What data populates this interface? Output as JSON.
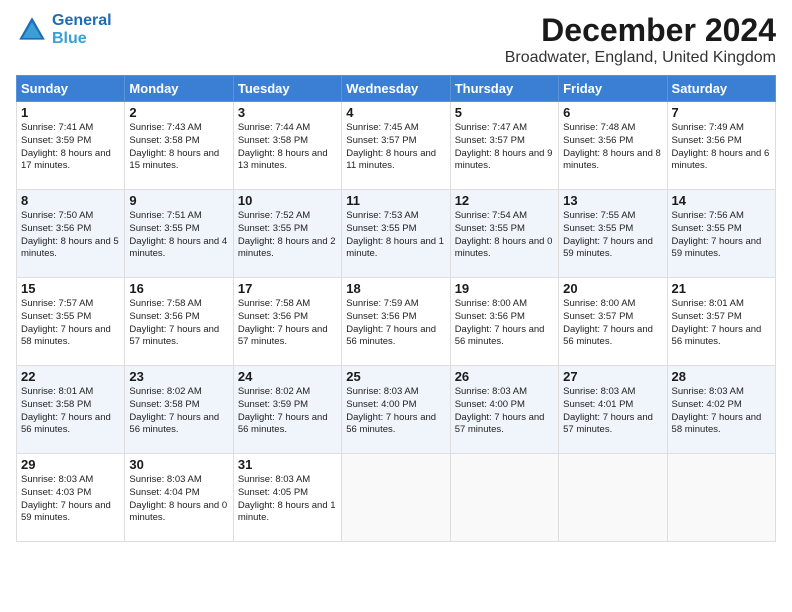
{
  "logo": {
    "line1": "General",
    "line2": "Blue"
  },
  "title": "December 2024",
  "location": "Broadwater, England, United Kingdom",
  "days_header": [
    "Sunday",
    "Monday",
    "Tuesday",
    "Wednesday",
    "Thursday",
    "Friday",
    "Saturday"
  ],
  "weeks": [
    [
      {
        "day": "1",
        "sunrise": "Sunrise: 7:41 AM",
        "sunset": "Sunset: 3:59 PM",
        "daylight": "Daylight: 8 hours and 17 minutes."
      },
      {
        "day": "2",
        "sunrise": "Sunrise: 7:43 AM",
        "sunset": "Sunset: 3:58 PM",
        "daylight": "Daylight: 8 hours and 15 minutes."
      },
      {
        "day": "3",
        "sunrise": "Sunrise: 7:44 AM",
        "sunset": "Sunset: 3:58 PM",
        "daylight": "Daylight: 8 hours and 13 minutes."
      },
      {
        "day": "4",
        "sunrise": "Sunrise: 7:45 AM",
        "sunset": "Sunset: 3:57 PM",
        "daylight": "Daylight: 8 hours and 11 minutes."
      },
      {
        "day": "5",
        "sunrise": "Sunrise: 7:47 AM",
        "sunset": "Sunset: 3:57 PM",
        "daylight": "Daylight: 8 hours and 9 minutes."
      },
      {
        "day": "6",
        "sunrise": "Sunrise: 7:48 AM",
        "sunset": "Sunset: 3:56 PM",
        "daylight": "Daylight: 8 hours and 8 minutes."
      },
      {
        "day": "7",
        "sunrise": "Sunrise: 7:49 AM",
        "sunset": "Sunset: 3:56 PM",
        "daylight": "Daylight: 8 hours and 6 minutes."
      }
    ],
    [
      {
        "day": "8",
        "sunrise": "Sunrise: 7:50 AM",
        "sunset": "Sunset: 3:56 PM",
        "daylight": "Daylight: 8 hours and 5 minutes."
      },
      {
        "day": "9",
        "sunrise": "Sunrise: 7:51 AM",
        "sunset": "Sunset: 3:55 PM",
        "daylight": "Daylight: 8 hours and 4 minutes."
      },
      {
        "day": "10",
        "sunrise": "Sunrise: 7:52 AM",
        "sunset": "Sunset: 3:55 PM",
        "daylight": "Daylight: 8 hours and 2 minutes."
      },
      {
        "day": "11",
        "sunrise": "Sunrise: 7:53 AM",
        "sunset": "Sunset: 3:55 PM",
        "daylight": "Daylight: 8 hours and 1 minute."
      },
      {
        "day": "12",
        "sunrise": "Sunrise: 7:54 AM",
        "sunset": "Sunset: 3:55 PM",
        "daylight": "Daylight: 8 hours and 0 minutes."
      },
      {
        "day": "13",
        "sunrise": "Sunrise: 7:55 AM",
        "sunset": "Sunset: 3:55 PM",
        "daylight": "Daylight: 7 hours and 59 minutes."
      },
      {
        "day": "14",
        "sunrise": "Sunrise: 7:56 AM",
        "sunset": "Sunset: 3:55 PM",
        "daylight": "Daylight: 7 hours and 59 minutes."
      }
    ],
    [
      {
        "day": "15",
        "sunrise": "Sunrise: 7:57 AM",
        "sunset": "Sunset: 3:55 PM",
        "daylight": "Daylight: 7 hours and 58 minutes."
      },
      {
        "day": "16",
        "sunrise": "Sunrise: 7:58 AM",
        "sunset": "Sunset: 3:56 PM",
        "daylight": "Daylight: 7 hours and 57 minutes."
      },
      {
        "day": "17",
        "sunrise": "Sunrise: 7:58 AM",
        "sunset": "Sunset: 3:56 PM",
        "daylight": "Daylight: 7 hours and 57 minutes."
      },
      {
        "day": "18",
        "sunrise": "Sunrise: 7:59 AM",
        "sunset": "Sunset: 3:56 PM",
        "daylight": "Daylight: 7 hours and 56 minutes."
      },
      {
        "day": "19",
        "sunrise": "Sunrise: 8:00 AM",
        "sunset": "Sunset: 3:56 PM",
        "daylight": "Daylight: 7 hours and 56 minutes."
      },
      {
        "day": "20",
        "sunrise": "Sunrise: 8:00 AM",
        "sunset": "Sunset: 3:57 PM",
        "daylight": "Daylight: 7 hours and 56 minutes."
      },
      {
        "day": "21",
        "sunrise": "Sunrise: 8:01 AM",
        "sunset": "Sunset: 3:57 PM",
        "daylight": "Daylight: 7 hours and 56 minutes."
      }
    ],
    [
      {
        "day": "22",
        "sunrise": "Sunrise: 8:01 AM",
        "sunset": "Sunset: 3:58 PM",
        "daylight": "Daylight: 7 hours and 56 minutes."
      },
      {
        "day": "23",
        "sunrise": "Sunrise: 8:02 AM",
        "sunset": "Sunset: 3:58 PM",
        "daylight": "Daylight: 7 hours and 56 minutes."
      },
      {
        "day": "24",
        "sunrise": "Sunrise: 8:02 AM",
        "sunset": "Sunset: 3:59 PM",
        "daylight": "Daylight: 7 hours and 56 minutes."
      },
      {
        "day": "25",
        "sunrise": "Sunrise: 8:03 AM",
        "sunset": "Sunset: 4:00 PM",
        "daylight": "Daylight: 7 hours and 56 minutes."
      },
      {
        "day": "26",
        "sunrise": "Sunrise: 8:03 AM",
        "sunset": "Sunset: 4:00 PM",
        "daylight": "Daylight: 7 hours and 57 minutes."
      },
      {
        "day": "27",
        "sunrise": "Sunrise: 8:03 AM",
        "sunset": "Sunset: 4:01 PM",
        "daylight": "Daylight: 7 hours and 57 minutes."
      },
      {
        "day": "28",
        "sunrise": "Sunrise: 8:03 AM",
        "sunset": "Sunset: 4:02 PM",
        "daylight": "Daylight: 7 hours and 58 minutes."
      }
    ],
    [
      {
        "day": "29",
        "sunrise": "Sunrise: 8:03 AM",
        "sunset": "Sunset: 4:03 PM",
        "daylight": "Daylight: 7 hours and 59 minutes."
      },
      {
        "day": "30",
        "sunrise": "Sunrise: 8:03 AM",
        "sunset": "Sunset: 4:04 PM",
        "daylight": "Daylight: 8 hours and 0 minutes."
      },
      {
        "day": "31",
        "sunrise": "Sunrise: 8:03 AM",
        "sunset": "Sunset: 4:05 PM",
        "daylight": "Daylight: 8 hours and 1 minute."
      },
      null,
      null,
      null,
      null
    ]
  ]
}
